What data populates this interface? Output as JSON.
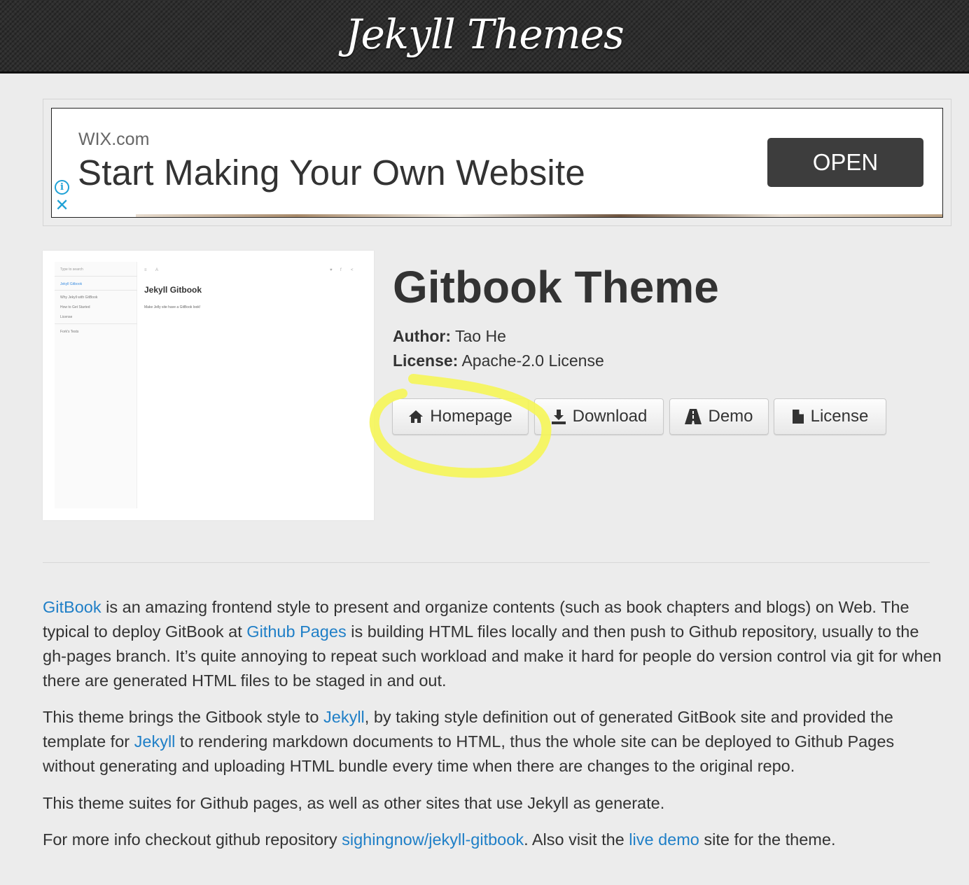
{
  "header": {
    "title": "Jekyll Themes"
  },
  "ad": {
    "brand": "WIX.com",
    "headline": "Start Making Your Own Website",
    "cta": "OPEN",
    "info_icon": "info-icon",
    "close_icon": "close-icon"
  },
  "preview": {
    "search": "Type to search",
    "nav": [
      "Jekyll Gitbook",
      "Why Jekyll with GitBook",
      "How to Get Started",
      "License",
      "Fork's Tests"
    ],
    "title": "Jekyll Gitbook",
    "subtitle": "Make Jelly site have a GitBook look!"
  },
  "theme": {
    "title": "Gitbook Theme",
    "author_label": "Author:",
    "author": "Tao He",
    "license_label": "License:",
    "license": "Apache-2.0 License"
  },
  "buttons": [
    {
      "label": "Homepage",
      "icon": "home-icon"
    },
    {
      "label": "Download",
      "icon": "download-icon"
    },
    {
      "label": "Demo",
      "icon": "road-icon"
    },
    {
      "label": "License",
      "icon": "file-icon"
    }
  ],
  "annotation": {
    "color": "#f5f55a"
  },
  "description": {
    "p1": {
      "link_gitbook": "GitBook",
      "t1": " is an amazing frontend style to present and organize contents (such as book chapters and blogs) on Web. The typical to deploy GitBook at ",
      "link_pages": "Github Pages",
      "t2": " is building HTML files locally and then push to Github repository, usually to the gh-pages branch. It’s quite annoying to repeat such workload and make it hard for people do version control via git for when there are generated HTML files to be staged in and out."
    },
    "p2": {
      "t1": "This theme brings the Gitbook style to ",
      "link_jekyll1": "Jekyll",
      "t2": ", by taking style definition out of generated GitBook site and provided the template for ",
      "link_jekyll2": "Jekyll",
      "t3": " to rendering markdown documents to HTML, thus the whole site can be deployed to Github Pages without generating and uploading HTML bundle every time when there are changes to the original repo."
    },
    "p3": "This theme suites for Github pages, as well as other sites that use Jekyll as generate.",
    "p4": {
      "t1": "For more info checkout github repository ",
      "link_repo": "sighingnow/jekyll-gitbook",
      "t2": ". Also visit the ",
      "link_demo": "live demo",
      "t3": " site for the theme."
    }
  },
  "colors": {
    "link": "#1f7fc7",
    "header_bg": "#2e2e2e",
    "ad_button": "#3d3d3d",
    "ad_icons": "#1ea1d6"
  }
}
